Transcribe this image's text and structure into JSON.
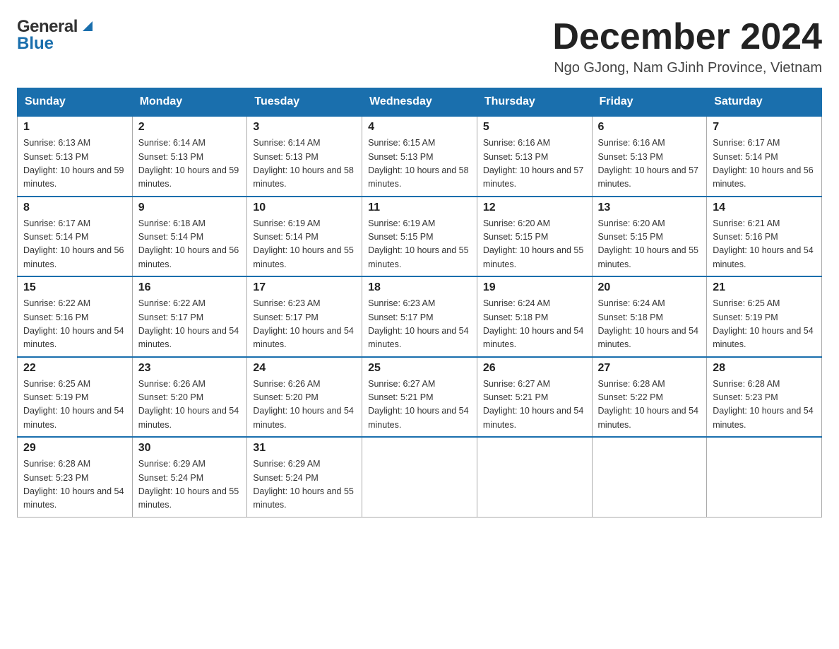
{
  "header": {
    "logo_general": "General",
    "logo_blue": "Blue",
    "month_title": "December 2024",
    "location": "Ngo GJong, Nam GJinh Province, Vietnam"
  },
  "days_of_week": [
    "Sunday",
    "Monday",
    "Tuesday",
    "Wednesday",
    "Thursday",
    "Friday",
    "Saturday"
  ],
  "weeks": [
    [
      {
        "day": "1",
        "sunrise": "6:13 AM",
        "sunset": "5:13 PM",
        "daylight": "10 hours and 59 minutes."
      },
      {
        "day": "2",
        "sunrise": "6:14 AM",
        "sunset": "5:13 PM",
        "daylight": "10 hours and 59 minutes."
      },
      {
        "day": "3",
        "sunrise": "6:14 AM",
        "sunset": "5:13 PM",
        "daylight": "10 hours and 58 minutes."
      },
      {
        "day": "4",
        "sunrise": "6:15 AM",
        "sunset": "5:13 PM",
        "daylight": "10 hours and 58 minutes."
      },
      {
        "day": "5",
        "sunrise": "6:16 AM",
        "sunset": "5:13 PM",
        "daylight": "10 hours and 57 minutes."
      },
      {
        "day": "6",
        "sunrise": "6:16 AM",
        "sunset": "5:13 PM",
        "daylight": "10 hours and 57 minutes."
      },
      {
        "day": "7",
        "sunrise": "6:17 AM",
        "sunset": "5:14 PM",
        "daylight": "10 hours and 56 minutes."
      }
    ],
    [
      {
        "day": "8",
        "sunrise": "6:17 AM",
        "sunset": "5:14 PM",
        "daylight": "10 hours and 56 minutes."
      },
      {
        "day": "9",
        "sunrise": "6:18 AM",
        "sunset": "5:14 PM",
        "daylight": "10 hours and 56 minutes."
      },
      {
        "day": "10",
        "sunrise": "6:19 AM",
        "sunset": "5:14 PM",
        "daylight": "10 hours and 55 minutes."
      },
      {
        "day": "11",
        "sunrise": "6:19 AM",
        "sunset": "5:15 PM",
        "daylight": "10 hours and 55 minutes."
      },
      {
        "day": "12",
        "sunrise": "6:20 AM",
        "sunset": "5:15 PM",
        "daylight": "10 hours and 55 minutes."
      },
      {
        "day": "13",
        "sunrise": "6:20 AM",
        "sunset": "5:15 PM",
        "daylight": "10 hours and 55 minutes."
      },
      {
        "day": "14",
        "sunrise": "6:21 AM",
        "sunset": "5:16 PM",
        "daylight": "10 hours and 54 minutes."
      }
    ],
    [
      {
        "day": "15",
        "sunrise": "6:22 AM",
        "sunset": "5:16 PM",
        "daylight": "10 hours and 54 minutes."
      },
      {
        "day": "16",
        "sunrise": "6:22 AM",
        "sunset": "5:17 PM",
        "daylight": "10 hours and 54 minutes."
      },
      {
        "day": "17",
        "sunrise": "6:23 AM",
        "sunset": "5:17 PM",
        "daylight": "10 hours and 54 minutes."
      },
      {
        "day": "18",
        "sunrise": "6:23 AM",
        "sunset": "5:17 PM",
        "daylight": "10 hours and 54 minutes."
      },
      {
        "day": "19",
        "sunrise": "6:24 AM",
        "sunset": "5:18 PM",
        "daylight": "10 hours and 54 minutes."
      },
      {
        "day": "20",
        "sunrise": "6:24 AM",
        "sunset": "5:18 PM",
        "daylight": "10 hours and 54 minutes."
      },
      {
        "day": "21",
        "sunrise": "6:25 AM",
        "sunset": "5:19 PM",
        "daylight": "10 hours and 54 minutes."
      }
    ],
    [
      {
        "day": "22",
        "sunrise": "6:25 AM",
        "sunset": "5:19 PM",
        "daylight": "10 hours and 54 minutes."
      },
      {
        "day": "23",
        "sunrise": "6:26 AM",
        "sunset": "5:20 PM",
        "daylight": "10 hours and 54 minutes."
      },
      {
        "day": "24",
        "sunrise": "6:26 AM",
        "sunset": "5:20 PM",
        "daylight": "10 hours and 54 minutes."
      },
      {
        "day": "25",
        "sunrise": "6:27 AM",
        "sunset": "5:21 PM",
        "daylight": "10 hours and 54 minutes."
      },
      {
        "day": "26",
        "sunrise": "6:27 AM",
        "sunset": "5:21 PM",
        "daylight": "10 hours and 54 minutes."
      },
      {
        "day": "27",
        "sunrise": "6:28 AM",
        "sunset": "5:22 PM",
        "daylight": "10 hours and 54 minutes."
      },
      {
        "day": "28",
        "sunrise": "6:28 AM",
        "sunset": "5:23 PM",
        "daylight": "10 hours and 54 minutes."
      }
    ],
    [
      {
        "day": "29",
        "sunrise": "6:28 AM",
        "sunset": "5:23 PM",
        "daylight": "10 hours and 54 minutes."
      },
      {
        "day": "30",
        "sunrise": "6:29 AM",
        "sunset": "5:24 PM",
        "daylight": "10 hours and 55 minutes."
      },
      {
        "day": "31",
        "sunrise": "6:29 AM",
        "sunset": "5:24 PM",
        "daylight": "10 hours and 55 minutes."
      },
      null,
      null,
      null,
      null
    ]
  ]
}
